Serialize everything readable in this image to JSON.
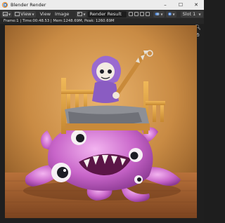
{
  "window": {
    "title": "Blender Render"
  },
  "header": {
    "view_label": "View",
    "view_menu": "View",
    "image_menu": "Image",
    "render_result": "Render Result",
    "slot_label": "Slot 1"
  },
  "info": {
    "text": "Frame:1 | Time:00:48.53 | Mem:1248.69M, Peak: 1260.69M"
  },
  "colors": {
    "accent": "#e87d0d",
    "header_bg": "#303030",
    "bg": "#1e1e1e"
  }
}
